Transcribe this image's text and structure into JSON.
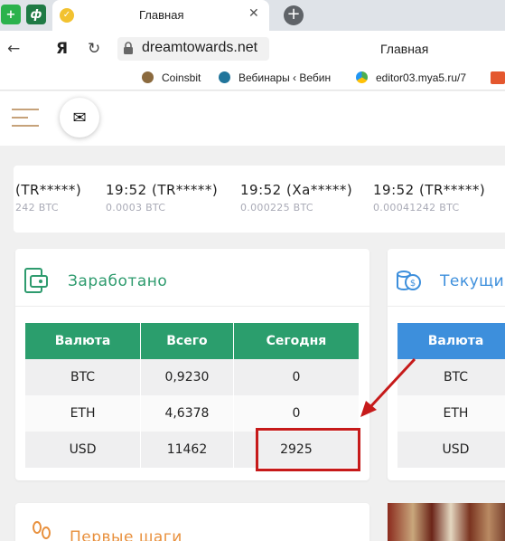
{
  "browser": {
    "tab_title": "Главная",
    "address": "dreamtowards.net",
    "page_title": "Главная",
    "bookmarks": [
      {
        "label": "Coinsbit"
      },
      {
        "label": "Вебинары ‹ Вебин"
      },
      {
        "label": "editor03.mya5.ru/7"
      }
    ]
  },
  "ticker": [
    {
      "time": "(TR*****)",
      "amount": "242 BTC"
    },
    {
      "time": "19:52 (TR*****)",
      "amount": "0.0003 BTC"
    },
    {
      "time": "19:52 (Xa*****)",
      "amount": "0.000225 BTC"
    },
    {
      "time": "19:52 (TR*****)",
      "amount": "0.00041242 BTC"
    }
  ],
  "earned": {
    "title": "Заработано",
    "headers": [
      "Валюта",
      "Всего",
      "Сегодня"
    ],
    "rows": [
      [
        "BTC",
        "0,9230",
        "0"
      ],
      [
        "ETH",
        "4,6378",
        "0"
      ],
      [
        "USD",
        "11462",
        "2925"
      ]
    ]
  },
  "current": {
    "title": "Текущий",
    "header": "Валюта",
    "rows": [
      "BTC",
      "ETH",
      "USD"
    ]
  },
  "steps": {
    "title": "Первые шаги"
  },
  "colors": {
    "green_accent": "#2b9e6d",
    "blue_accent": "#3d8fdc",
    "orange_accent": "#e8903d",
    "annotation_red": "#c61a1a"
  }
}
